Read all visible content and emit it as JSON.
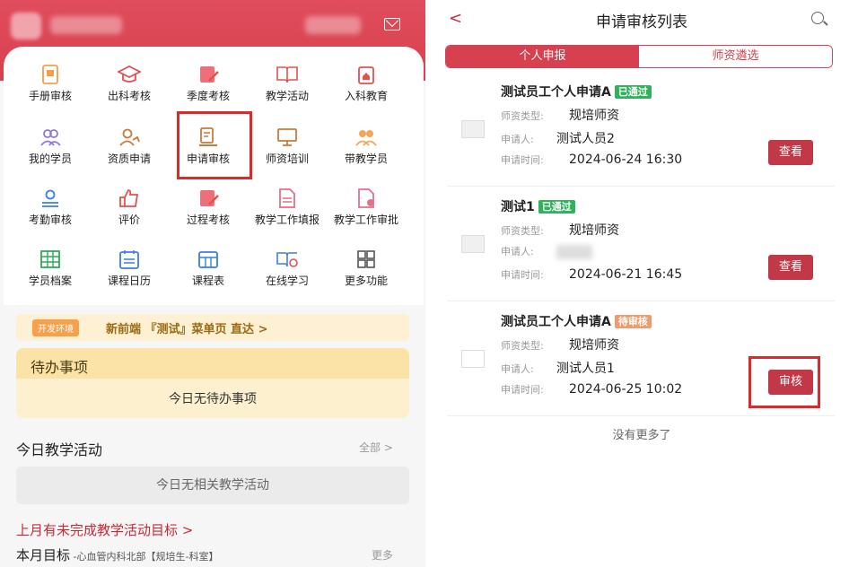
{
  "left": {
    "menu": [
      {
        "label": "手册审核",
        "icon": "handbook-icon"
      },
      {
        "label": "出科考核",
        "icon": "graduation-cap-icon"
      },
      {
        "label": "季度考核",
        "icon": "quarterly-edit-icon"
      },
      {
        "label": "教学活动",
        "icon": "book-icon"
      },
      {
        "label": "入科教育",
        "icon": "house-icon"
      },
      {
        "label": "我的学员",
        "icon": "users-icon"
      },
      {
        "label": "资质申请",
        "icon": "user-qualify-icon"
      },
      {
        "label": "申请审核",
        "icon": "audit-doc-icon"
      },
      {
        "label": "师资培训",
        "icon": "board-icon"
      },
      {
        "label": "带教学员",
        "icon": "team-icon"
      },
      {
        "label": "考勤审核",
        "icon": "attendance-icon"
      },
      {
        "label": "评价",
        "icon": "thumbs-up-icon"
      },
      {
        "label": "过程考核",
        "icon": "process-edit-icon"
      },
      {
        "label": "教学工作填报",
        "icon": "report-doc-icon"
      },
      {
        "label": "教学工作审批",
        "icon": "approval-doc-icon"
      },
      {
        "label": "学员档案",
        "icon": "grid-table-icon"
      },
      {
        "label": "课程日历",
        "icon": "calendar-icon"
      },
      {
        "label": "课程表",
        "icon": "timetable-icon"
      },
      {
        "label": "在线学习",
        "icon": "online-learn-icon"
      },
      {
        "label": "更多功能",
        "icon": "more-grid-icon"
      }
    ],
    "dev_tag": "开发环境",
    "dev_text": "新前端 『测试』菜单页 直达 >",
    "todo_title": "待办事项",
    "todo_empty": "今日无待办事项",
    "activity_title": "今日教学活动",
    "activity_all": "全部 >",
    "activity_empty": "今日无相关教学活动",
    "unfinished": "上月有未完成教学活动目标  >",
    "target_title": "本月目标",
    "target_sub": " -心血管内科北部【规培生-科室】",
    "target_more": "更多"
  },
  "right": {
    "back": "<",
    "title": "申请审核列表",
    "tabs": [
      "个人申报",
      "师资遴选"
    ],
    "records": [
      {
        "name": "测试员工个人申请A",
        "status": "已通过",
        "type_label": "师资类型:",
        "type": "规培师资",
        "applicant_label": "申请人:",
        "applicant": "测试人员2",
        "time_label": "申请时间:",
        "time": "2024-06-24 16:30",
        "action": "查看"
      },
      {
        "name": "测试1",
        "status": "已通过",
        "type_label": "师资类型:",
        "type": "规培师资",
        "applicant_label": "申请人:",
        "applicant": "",
        "time_label": "申请时间:",
        "time": "2024-06-21 16:45",
        "action": "查看"
      },
      {
        "name": "测试员工个人申请A",
        "status": "待审核",
        "type_label": "师资类型:",
        "type": "规培师资",
        "applicant_label": "申请人:",
        "applicant": "测试人员1",
        "time_label": "申请时间:",
        "time": "2024-06-25 10:02",
        "action": "审核"
      }
    ],
    "no_more": "没有更多了"
  },
  "colors": {
    "brand_red": "#d6404f",
    "approved": "#2fb35a",
    "pending": "#f29a6b",
    "highlight": "#d92b2b"
  }
}
